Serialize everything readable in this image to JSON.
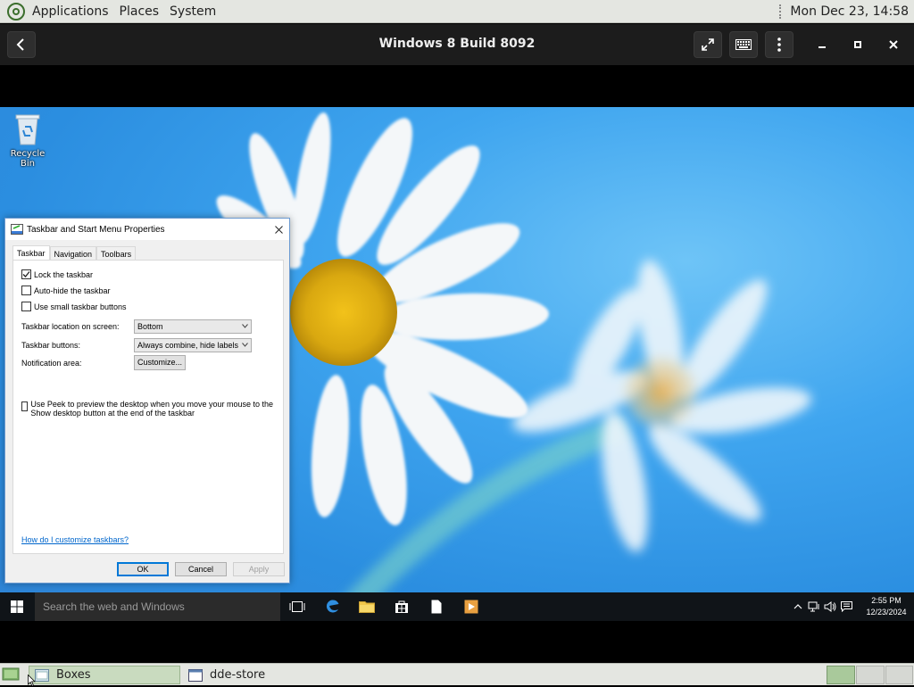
{
  "top_panel": {
    "menus": [
      "Applications",
      "Places",
      "System"
    ],
    "clock": "Mon Dec 23, 14:58"
  },
  "boxes": {
    "title": "Windows 8 Build 8092"
  },
  "desktop": {
    "recycle_bin_label": "Recycle Bin"
  },
  "dialog": {
    "title": "Taskbar and Start Menu Properties",
    "tabs": [
      "Taskbar",
      "Navigation",
      "Toolbars"
    ],
    "active_tab": "Taskbar",
    "checkboxes": [
      {
        "label": "Lock the taskbar",
        "checked": true
      },
      {
        "label": "Auto-hide the taskbar",
        "checked": false
      },
      {
        "label": "Use small taskbar buttons",
        "checked": false
      }
    ],
    "location_label": "Taskbar location on screen:",
    "location_value": "Bottom",
    "buttons_label": "Taskbar buttons:",
    "buttons_value": "Always combine, hide labels",
    "notification_label": "Notification area:",
    "customize_label": "Customize...",
    "peek_label": "Use Peek to preview the desktop when you move your mouse to the Show desktop button at the end of the taskbar",
    "peek_checked": false,
    "help_link": "How do I customize taskbars?",
    "ok_label": "OK",
    "cancel_label": "Cancel",
    "apply_label": "Apply"
  },
  "win_taskbar": {
    "search_placeholder": "Search the web and Windows",
    "clock_time": "2:55 PM",
    "clock_date": "12/23/2024"
  },
  "bottom_panel": {
    "tasks": [
      "Boxes",
      "dde-store"
    ]
  },
  "colors": {
    "gnome_panel": "#e4e6e1",
    "win_accent": "#0078d7",
    "desktop_blue": "#3fa5ef"
  }
}
